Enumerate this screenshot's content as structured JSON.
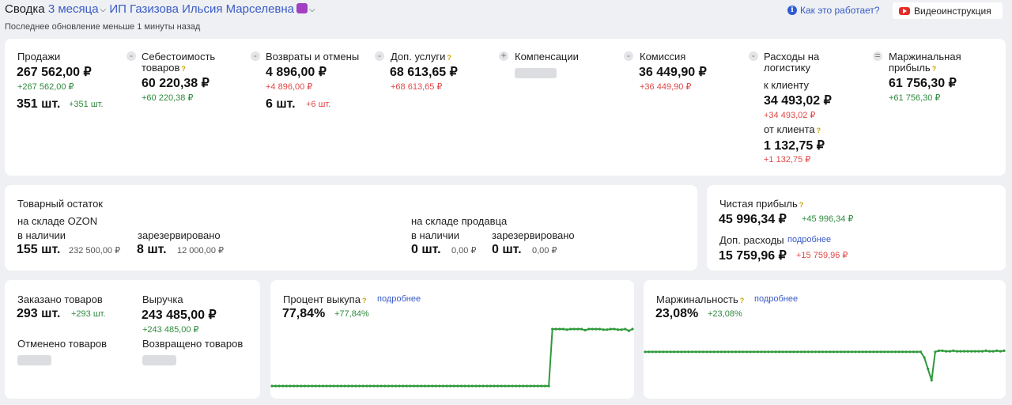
{
  "header": {
    "prefix": "Сводка",
    "period": "3 месяца",
    "company": "ИП Газизова Ильсия Марселевна",
    "subtitle": "Последнее обновление меньше 1 минуты назад",
    "how_label": "Как это работает?",
    "video_label": "Видеоинструкция"
  },
  "summary": {
    "sales": {
      "label": "Продажи",
      "value": "267 562,00 ₽",
      "delta": "+267 562,00 ₽",
      "count": "351 шт.",
      "count_delta": "+351 шт."
    },
    "cost": {
      "op": "-",
      "label1": "Себестоимость",
      "label2": "товаров",
      "help": "?",
      "value": "60 220,38 ₽",
      "delta": "+60 220,38 ₽"
    },
    "returns": {
      "op": "-",
      "label": "Возвраты и отмены",
      "value": "4 896,00 ₽",
      "delta": "+4 896,00 ₽",
      "count": "6 шт.",
      "count_delta": "+6 шт."
    },
    "services": {
      "op": "-",
      "label": "Доп. услуги",
      "help": "?",
      "value": "68 613,65 ₽",
      "delta": "+68 613,65 ₽"
    },
    "compensations": {
      "op": "+",
      "label": "Компенсации"
    },
    "commission": {
      "op": "-",
      "label": "Комиссия",
      "value": "36 449,90 ₽",
      "delta": "+36 449,90 ₽"
    },
    "logistics": {
      "op": "-",
      "label1": "Расходы на",
      "label2": "логистику",
      "to_label": "к клиенту",
      "to_value": "34 493,02 ₽",
      "to_delta": "+34 493,02 ₽",
      "from_label": "от клиента",
      "help": "?",
      "from_value": "1 132,75 ₽",
      "from_delta": "+1 132,75 ₽"
    },
    "margin": {
      "op": "=",
      "label1": "Маржинальная",
      "label2": "прибыль",
      "help": "?",
      "value": "61 756,30 ₽",
      "delta": "+61 756,30 ₽"
    }
  },
  "stock": {
    "title": "Товарный остаток",
    "ozon": {
      "title": "на складе OZON",
      "avail_label": "в наличии",
      "avail_count": "155 шт.",
      "avail_sum": "232 500,00 ₽",
      "res_label": "зарезервировано",
      "res_count": "8 шт.",
      "res_sum": "12 000,00 ₽"
    },
    "seller": {
      "title": "на складе продавца",
      "avail_label": "в наличии",
      "avail_count": "0 шт.",
      "avail_sum": "0,00 ₽",
      "res_label": "зарезервировано",
      "res_count": "0 шт.",
      "res_sum": "0,00 ₽"
    }
  },
  "profit": {
    "label": "Чистая прибыль",
    "help": "?",
    "value": "45 996,34 ₽",
    "delta": "+45 996,34 ₽",
    "extra_label": "Доп. расходы",
    "extra_link": "подробнее",
    "extra_value": "15 759,96 ₽",
    "extra_delta": "+15 759,96 ₽"
  },
  "orders": {
    "ordered_label": "Заказано товаров",
    "ordered_value": "293 шт.",
    "ordered_delta": "+293 шт.",
    "revenue_label": "Выручка",
    "revenue_value": "243 485,00 ₽",
    "revenue_delta": "+243 485,00 ₽",
    "cancelled_label": "Отменено товаров",
    "returned_label": "Возвращено товаров"
  },
  "buyout": {
    "label": "Процент выкупа",
    "help": "?",
    "link": "подробнее",
    "value": "77,84%",
    "delta": "+77,84%"
  },
  "marginality": {
    "label": "Маржинальность",
    "help": "?",
    "link": "подробнее",
    "value": "23,08%",
    "delta": "+23,08%"
  },
  "colors": {
    "accent": "#3a5bc7",
    "positive": "#2e8b3e",
    "negative": "#e04848",
    "chart_line": "#2e9a3a",
    "help": "#c9a400"
  },
  "chart_data": [
    {
      "type": "line",
      "series": [
        {
          "values": [
            0,
            0,
            0,
            0,
            0,
            0,
            0,
            0,
            0,
            0,
            0,
            0,
            0,
            0,
            0,
            0,
            0,
            0,
            0,
            0,
            0,
            0,
            0,
            0,
            0,
            0,
            0,
            0,
            0,
            0,
            0,
            0,
            0,
            0,
            0,
            0,
            0,
            0,
            0,
            0,
            0,
            0,
            0,
            0,
            0,
            0,
            0,
            0,
            0,
            0,
            0,
            0,
            0,
            0,
            0,
            0,
            0,
            0,
            0,
            0,
            0,
            0,
            0,
            0,
            0,
            0,
            0,
            0,
            0,
            0,
            0,
            0,
            0,
            0,
            0,
            0,
            0,
            1,
            1,
            1,
            1,
            0.99,
            1,
            1,
            1,
            1,
            0.98,
            1,
            1,
            1,
            1,
            0.99,
            0.99,
            1,
            1,
            0.99,
            0.99,
            1,
            0.97,
            1
          ]
        }
      ]
    },
    {
      "type": "line",
      "series": [
        {
          "values": [
            0.6,
            0.6,
            0.6,
            0.6,
            0.6,
            0.6,
            0.6,
            0.6,
            0.6,
            0.6,
            0.6,
            0.6,
            0.6,
            0.6,
            0.6,
            0.6,
            0.6,
            0.6,
            0.6,
            0.6,
            0.6,
            0.6,
            0.6,
            0.6,
            0.6,
            0.6,
            0.6,
            0.6,
            0.6,
            0.6,
            0.6,
            0.6,
            0.6,
            0.6,
            0.6,
            0.6,
            0.6,
            0.6,
            0.6,
            0.6,
            0.6,
            0.6,
            0.6,
            0.6,
            0.6,
            0.6,
            0.6,
            0.6,
            0.6,
            0.6,
            0.6,
            0.6,
            0.6,
            0.6,
            0.6,
            0.6,
            0.6,
            0.6,
            0.6,
            0.6,
            0.6,
            0.6,
            0.6,
            0.6,
            0.6,
            0.6,
            0.6,
            0.6,
            0.6,
            0.6,
            0.6,
            0.6,
            0.6,
            0.6,
            0.6,
            0.6,
            0.6,
            0.5,
            0.3,
            0.1,
            0.6,
            0.62,
            0.62,
            0.61,
            0.61,
            0.62,
            0.61,
            0.61,
            0.61,
            0.61,
            0.61,
            0.61,
            0.61,
            0.61,
            0.62,
            0.61,
            0.61,
            0.62,
            0.61,
            0.62
          ]
        }
      ]
    }
  ]
}
